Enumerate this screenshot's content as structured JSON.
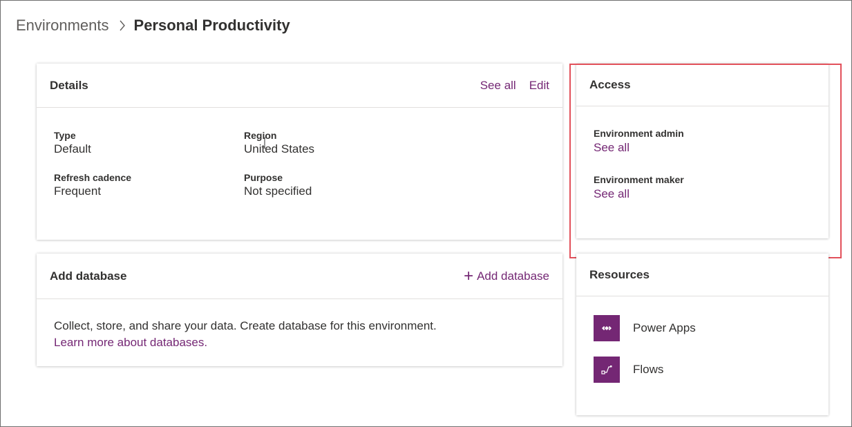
{
  "breadcrumb": {
    "parent": "Environments",
    "current": "Personal Productivity"
  },
  "details": {
    "title": "Details",
    "see_all": "See all",
    "edit": "Edit",
    "fields": [
      {
        "label": "Type",
        "value": "Default"
      },
      {
        "label": "Region",
        "value": "United States"
      },
      {
        "label": "Refresh cadence",
        "value": "Frequent"
      },
      {
        "label": "Purpose",
        "value": "Not specified"
      }
    ]
  },
  "access": {
    "title": "Access",
    "items": [
      {
        "label": "Environment admin",
        "link": "See all"
      },
      {
        "label": "Environment maker",
        "link": "See all"
      }
    ]
  },
  "add_database": {
    "title": "Add database",
    "action": "Add database",
    "description": "Collect, store, and share your data. Create database for this environment.",
    "learn_more": "Learn more about databases."
  },
  "resources": {
    "title": "Resources",
    "items": [
      {
        "label": "Power Apps",
        "icon": "power-apps-icon"
      },
      {
        "label": "Flows",
        "icon": "flows-icon"
      }
    ]
  },
  "colors": {
    "accent": "#742774",
    "highlight": "#e2505a",
    "text": "#323130"
  }
}
